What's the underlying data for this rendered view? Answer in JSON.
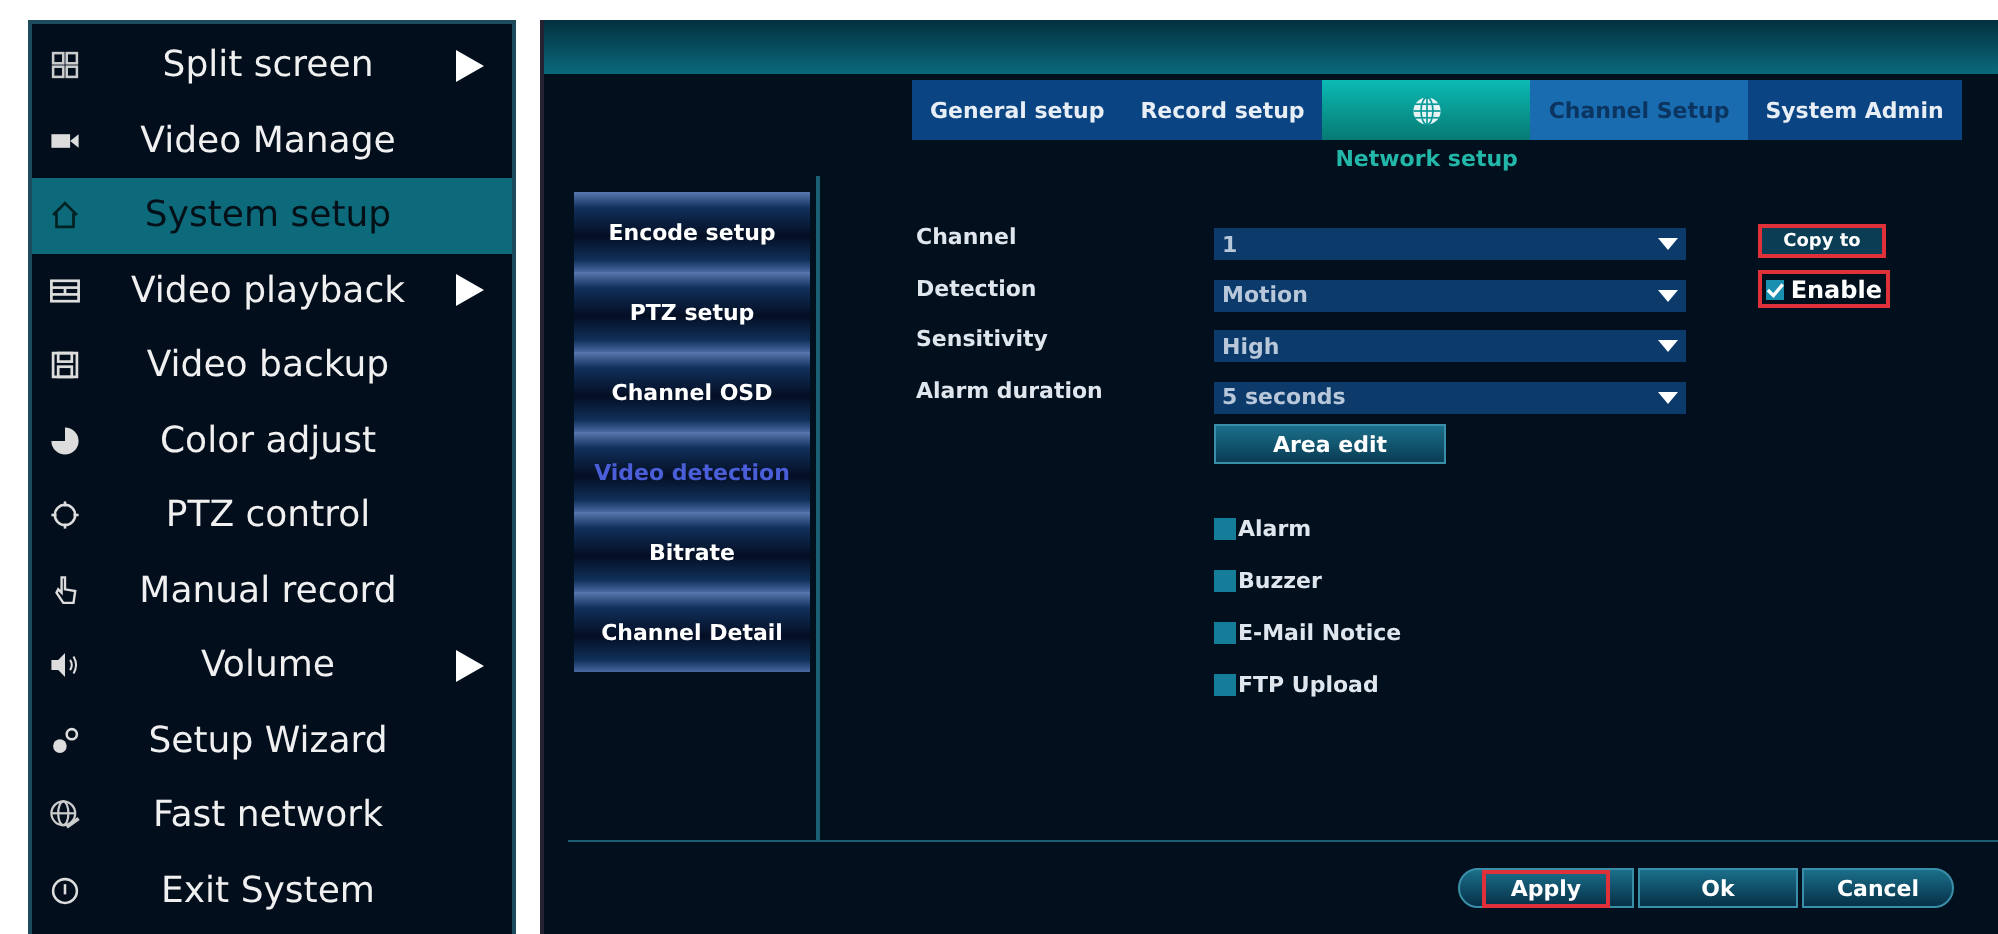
{
  "main_menu": {
    "items": [
      {
        "label": "Split screen",
        "selected": false,
        "submenu": true
      },
      {
        "label": "Video Manage",
        "selected": false,
        "submenu": false
      },
      {
        "label": "System setup",
        "selected": true,
        "submenu": false
      },
      {
        "label": "Video playback",
        "selected": false,
        "submenu": true
      },
      {
        "label": "Video backup",
        "selected": false,
        "submenu": false
      },
      {
        "label": "Color adjust",
        "selected": false,
        "submenu": false
      },
      {
        "label": "PTZ control",
        "selected": false,
        "submenu": false
      },
      {
        "label": "Manual record",
        "selected": false,
        "submenu": false
      },
      {
        "label": "Volume",
        "selected": false,
        "submenu": true
      },
      {
        "label": "Setup Wizard",
        "selected": false,
        "submenu": false
      },
      {
        "label": "Fast network",
        "selected": false,
        "submenu": false
      },
      {
        "label": "Exit System",
        "selected": false,
        "submenu": false
      }
    ]
  },
  "tabs": [
    {
      "kind": "text",
      "label": "General setup",
      "selected": false,
      "hovered": false
    },
    {
      "kind": "text",
      "label": "Record setup",
      "selected": false,
      "hovered": false
    },
    {
      "kind": "icon",
      "label": "Network setup",
      "selected": true,
      "hovered": false
    },
    {
      "kind": "text",
      "label": "Channel Setup",
      "selected": false,
      "hovered": true
    },
    {
      "kind": "text",
      "label": "System Admin",
      "selected": false,
      "hovered": false
    }
  ],
  "side_menu": [
    {
      "label": "Encode setup",
      "selected": false
    },
    {
      "label": "PTZ setup",
      "selected": false
    },
    {
      "label": "Channel OSD",
      "selected": false
    },
    {
      "label": "Video detection",
      "selected": true
    },
    {
      "label": "Bitrate",
      "selected": false
    },
    {
      "label": "Channel Detail",
      "selected": false
    }
  ],
  "form": {
    "fields": [
      {
        "label": "Channel",
        "value": "1"
      },
      {
        "label": "Detection",
        "value": "Motion"
      },
      {
        "label": "Sensitivity",
        "value": "High"
      },
      {
        "label": "Alarm duration",
        "value": "5 seconds"
      }
    ],
    "copy_button": {
      "label": "Copy to",
      "highlighted": true
    },
    "enable": {
      "label": "Enable",
      "checked": true,
      "highlighted": true
    },
    "area_edit_button": "Area edit",
    "options": [
      {
        "label": "Alarm",
        "checked": false
      },
      {
        "label": "Buzzer",
        "checked": false
      },
      {
        "label": "E-Mail Notice",
        "checked": false
      },
      {
        "label": "FTP Upload",
        "checked": false
      }
    ]
  },
  "buttons": [
    {
      "label": "Apply",
      "highlighted": true
    },
    {
      "label": "Ok",
      "highlighted": false
    },
    {
      "label": "Cancel",
      "highlighted": false
    }
  ]
}
